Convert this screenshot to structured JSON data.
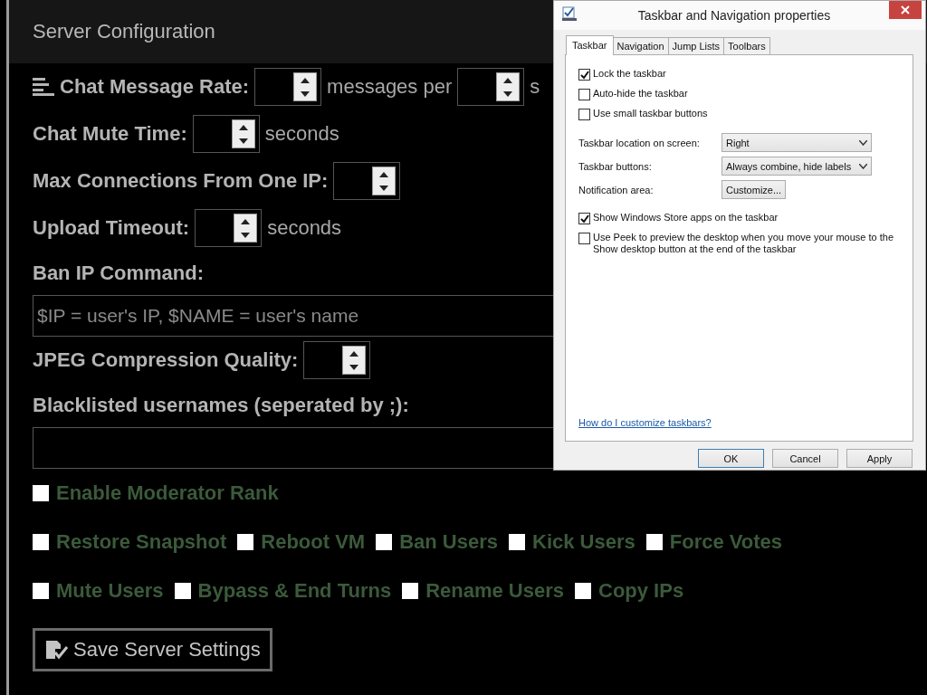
{
  "header": {
    "title": "Server Configuration"
  },
  "settings": [
    {
      "kind": "inline",
      "parts": [
        {
          "kind": "label",
          "text": "Chat Message Rate:"
        },
        {
          "kind": "spinner"
        },
        {
          "kind": "unit",
          "text": "messages per"
        },
        {
          "kind": "spinner"
        },
        {
          "kind": "unit",
          "text": "s"
        }
      ]
    },
    {
      "kind": "inline",
      "parts": [
        {
          "kind": "label",
          "text": "Chat Mute Time:"
        },
        {
          "kind": "spinner"
        },
        {
          "kind": "unit",
          "text": "seconds"
        }
      ]
    },
    {
      "kind": "inline",
      "parts": [
        {
          "kind": "label",
          "text": "Max Connections From One IP:"
        },
        {
          "kind": "spinner"
        }
      ]
    },
    {
      "kind": "inline",
      "parts": [
        {
          "kind": "label",
          "text": "Upload Timeout:"
        },
        {
          "kind": "spinner"
        },
        {
          "kind": "unit",
          "text": "seconds"
        }
      ]
    },
    {
      "kind": "heading",
      "text": "Ban IP Command:"
    },
    {
      "kind": "text_field",
      "placeholder": "$IP = user's IP, $NAME = user's name"
    },
    {
      "kind": "inline",
      "parts": [
        {
          "kind": "label",
          "text": "JPEG Compression Quality:"
        },
        {
          "kind": "spinner"
        }
      ]
    },
    {
      "kind": "heading",
      "text": "Blacklisted usernames (seperated by ;):"
    },
    {
      "kind": "text_field"
    },
    {
      "kind": "checks",
      "items": [
        {
          "label": "Enable Moderator Rank",
          "checked": false
        }
      ]
    },
    {
      "kind": "checks",
      "items": [
        {
          "label": "Restore Snapshot",
          "checked": false
        },
        {
          "label": "Reboot VM",
          "checked": false
        },
        {
          "label": "Ban Users",
          "checked": false
        },
        {
          "label": "Kick Users",
          "checked": false
        },
        {
          "label": "Force Votes",
          "checked": false
        }
      ]
    },
    {
      "kind": "checks",
      "items": [
        {
          "label": "Mute Users",
          "checked": false
        },
        {
          "label": "Bypass & End Turns",
          "checked": false
        },
        {
          "label": "Rename Users",
          "checked": false
        },
        {
          "label": "Copy IPs",
          "checked": false
        }
      ]
    },
    {
      "kind": "save_button",
      "label": "Save Server Settings"
    }
  ],
  "dialog": {
    "title": "Taskbar and Navigation properties",
    "tabs": [
      {
        "label": "Taskbar",
        "selected": true
      },
      {
        "label": "Navigation",
        "selected": false
      },
      {
        "label": "Jump Lists",
        "selected": false
      },
      {
        "label": "Toolbars",
        "selected": false
      }
    ],
    "sections": [
      [
        {
          "kind": "checkbox",
          "label": "Lock the taskbar",
          "checked": true
        },
        {
          "kind": "checkbox",
          "label": "Auto-hide the taskbar",
          "checked": false
        },
        {
          "kind": "checkbox",
          "label": "Use small taskbar buttons",
          "checked": false
        }
      ],
      [
        {
          "kind": "select",
          "label": "Taskbar location on screen:",
          "value": "Right"
        },
        {
          "kind": "select",
          "label": "Taskbar buttons:",
          "value": "Always combine, hide labels"
        },
        {
          "kind": "button",
          "label": "Notification area:",
          "button": "Customize..."
        }
      ],
      [
        {
          "kind": "checkbox",
          "label": "Show Windows Store apps on the taskbar",
          "checked": true
        },
        {
          "kind": "checkbox",
          "label": "Use Peek to preview the desktop when you move your mouse to the Show desktop button at the end of the taskbar",
          "checked": false
        }
      ]
    ],
    "help_link": "How do I customize taskbars?",
    "buttons": [
      {
        "label": "OK",
        "default": true
      },
      {
        "label": "Cancel",
        "default": false
      },
      {
        "label": "Apply",
        "default": false
      }
    ]
  }
}
